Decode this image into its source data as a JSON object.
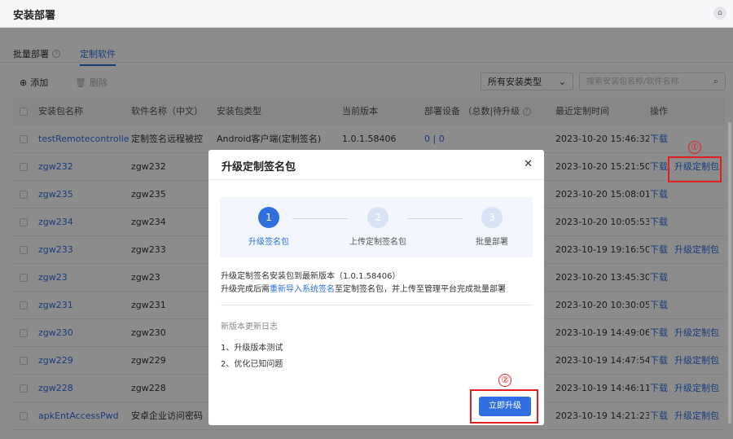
{
  "header": {
    "title": "安装部署"
  },
  "tabs": [
    {
      "label": "批量部署"
    },
    {
      "label": "定制软件"
    }
  ],
  "toolbar": {
    "add_label": "添加",
    "delete_label": "删除",
    "type_select_value": "所有安装类型",
    "search_placeholder": "搜索安装包名称/软件名称"
  },
  "table": {
    "columns": [
      "安装包名称",
      "软件名称（中文）",
      "安装包类型",
      "当前版本",
      "部署设备 （总数|待升级",
      "最近定制时间",
      "操作"
    ],
    "rows": [
      {
        "name": "testRemotecontrolled",
        "soft": "定制签名远程被控",
        "type": "Android客户端(定制签名)",
        "version": "1.0.1.58406",
        "deploy": "0 | 0",
        "time": "2023-10-20 15:46:32",
        "op1": "下载",
        "op2": ""
      },
      {
        "name": "zgw232",
        "soft": "zgw232",
        "type": "",
        "version": "",
        "deploy": "",
        "time": "2023-10-20 15:21:50",
        "op1": "下载",
        "op2": "升级定制包"
      },
      {
        "name": "zgw235",
        "soft": "zgw235",
        "type": "",
        "version": "",
        "deploy": "",
        "time": "2023-10-20 15:08:01",
        "op1": "下载",
        "op2": ""
      },
      {
        "name": "zgw234",
        "soft": "zgw234",
        "type": "",
        "version": "",
        "deploy": "",
        "time": "2023-10-20 10:05:53",
        "op1": "下载",
        "op2": ""
      },
      {
        "name": "zgw233",
        "soft": "zgw233",
        "type": "",
        "version": "",
        "deploy": "",
        "time": "2023-10-19 19:16:50",
        "op1": "下载",
        "op2": "升级定制包"
      },
      {
        "name": "zgw23",
        "soft": "zgw23",
        "type": "",
        "version": "",
        "deploy": "",
        "time": "2023-10-20 13:45:30",
        "op1": "下载",
        "op2": ""
      },
      {
        "name": "zgw231",
        "soft": "zgw231",
        "type": "",
        "version": "",
        "deploy": "",
        "time": "2023-10-20 10:30:05",
        "op1": "下载",
        "op2": ""
      },
      {
        "name": "zgw230",
        "soft": "zgw230",
        "type": "",
        "version": "",
        "deploy": "",
        "time": "2023-10-19 14:49:06",
        "op1": "下载",
        "op2": "升级定制包"
      },
      {
        "name": "zgw229",
        "soft": "zgw229",
        "type": "",
        "version": "",
        "deploy": "",
        "time": "2023-10-19 14:47:54",
        "op1": "下载",
        "op2": "升级定制包"
      },
      {
        "name": "zgw228",
        "soft": "zgw228",
        "type": "",
        "version": "",
        "deploy": "",
        "time": "2023-10-19 14:46:11",
        "op1": "下载",
        "op2": "升级定制包"
      },
      {
        "name": "apkEntAccessPwd",
        "soft": "安卓企业访问密码",
        "type": "",
        "version": "",
        "deploy": "",
        "time": "2023-10-19 14:21:23",
        "op1": "下载",
        "op2": "升级定制包"
      }
    ]
  },
  "modal": {
    "title": "升级定制签名包",
    "steps": [
      {
        "num": "1",
        "label": "升级签名包"
      },
      {
        "num": "2",
        "label": "上传定制签名包"
      },
      {
        "num": "3",
        "label": "批量部署"
      }
    ],
    "info_line1": "升级定制签名安装包到最新版本（1.0.1.58406）",
    "info_line2_pre": "升级完成后需",
    "info_line2_link": "重新导入系统签名",
    "info_line2_post": "至定制签名包，并上传至管理平台完成批量部署",
    "log_title": "新版本更新日志",
    "log_items": [
      "1、升级版本测试",
      "2、优化已知问题"
    ],
    "upgrade_label": "立即升级"
  },
  "annotations": {
    "marker1": "①",
    "marker2": "②"
  },
  "colors": {
    "accent": "#2f6fe0",
    "highlight": "#e02020"
  }
}
